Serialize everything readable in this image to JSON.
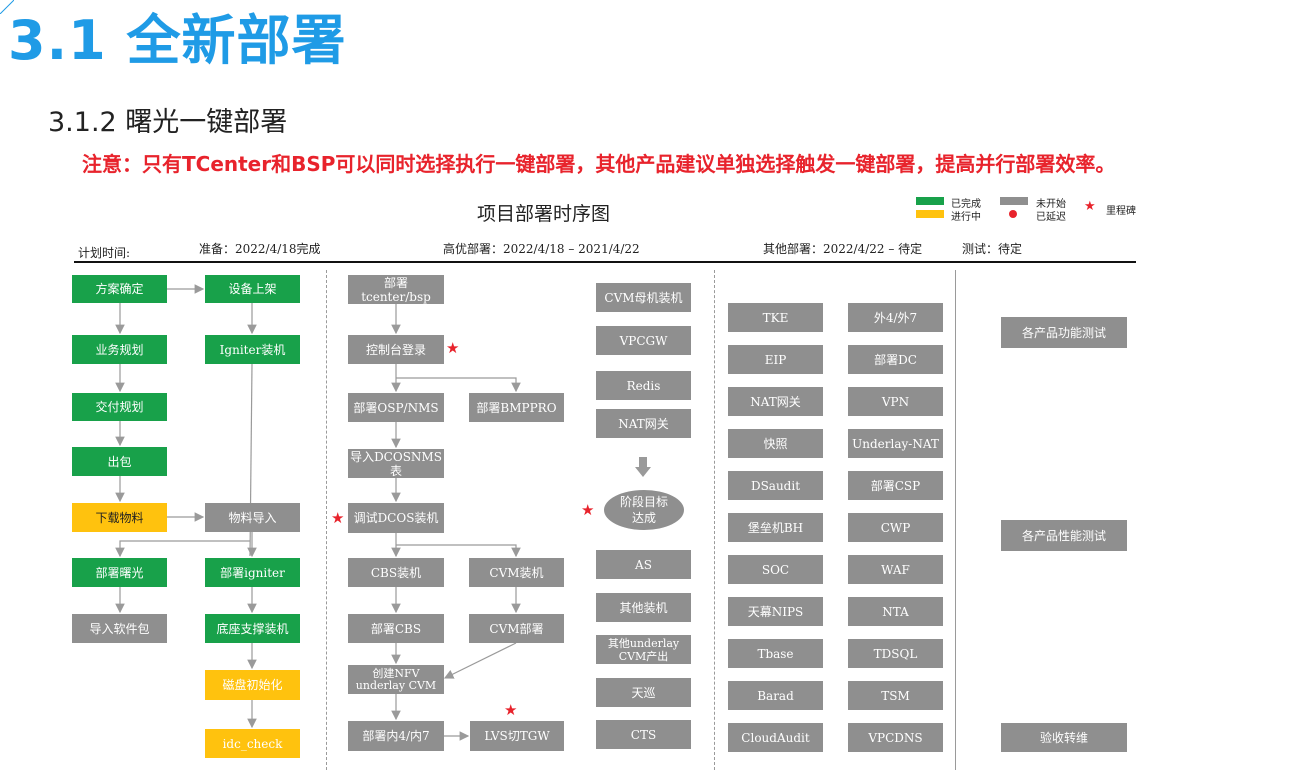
{
  "header": {
    "title": "3.1 全新部署",
    "subtitle": "3.1.2 曙光一键部署",
    "note": "注意：只有TCenter和BSP可以同时选择执行一键部署，其他产品建议单独选择触发一键部署，提高并行部署效率。"
  },
  "diagram": {
    "title": "项目部署时序图",
    "legend": {
      "done": "已完成",
      "in_progress": "进行中",
      "not_started": "未开始",
      "delayed": "已延迟",
      "milestone": "里程碑"
    },
    "phases": {
      "plan_label": "计划时间:",
      "prep": "准备：2022/4/18完成",
      "priority": "高优部署：2022/4/18 – 2021/4/22",
      "other": "其他部署：2022/4/22 – 待定",
      "test": "测试：待定"
    },
    "prep": {
      "b1": "方案确定",
      "b2": "设备上架",
      "b3": "业务规划",
      "b4": "Igniter装机",
      "b5": "交付规划",
      "b6": "出包",
      "b7": "下载物料",
      "b8": "物料导入",
      "b9": "部署曙光",
      "b10": "部署igniter",
      "b11": "导入软件包",
      "b12": "底座支撑装机",
      "b13": "磁盘初始化",
      "b14": "idc_check"
    },
    "priority": {
      "p1": "部署tcenter/bsp",
      "p2": "控制台登录",
      "p3": "部署OSP/NMS",
      "p4": "部署BMPPRO",
      "p5": "导入DCOSNMS表",
      "p6": "调试DCOS装机",
      "p7": "CBS装机",
      "p8": "CVM装机",
      "p9": "部署CBS",
      "p10": "CVM部署",
      "p11": "创建NFV underlay CVM",
      "p12": "部署内4/内7",
      "p13": "LVS切TGW"
    },
    "middle": {
      "m1": "CVM母机装机",
      "m2": "VPCGW",
      "m3": "Redis",
      "m4": "NAT网关",
      "milestone": "阶段目标达成",
      "m5": "AS",
      "m6": "其他装机",
      "m7": "其他underlay CVM产出",
      "m8": "天巡",
      "m9": "CTS"
    },
    "other_left": [
      "TKE",
      "EIP",
      "NAT网关",
      "快照",
      "DSaudit",
      "堡垒机BH",
      "SOC",
      "天幕NIPS",
      "Tbase",
      "Barad",
      "CloudAudit"
    ],
    "other_right": [
      "外4/外7",
      "部署DC",
      "VPN",
      "Underlay-NAT",
      "部署CSP",
      "CWP",
      "WAF",
      "NTA",
      "TDSQL",
      "TSM",
      "VPCDNS"
    ],
    "test": {
      "t1": "各产品功能测试",
      "t2": "各产品性能测试",
      "t3": "验收转维"
    }
  },
  "colors": {
    "title_blue": "#1f9be6",
    "note_red": "#e8232c",
    "done_green": "#18a14a",
    "in_progress_yellow": "#ffc20e",
    "not_started_gray": "#8f8f8f"
  }
}
